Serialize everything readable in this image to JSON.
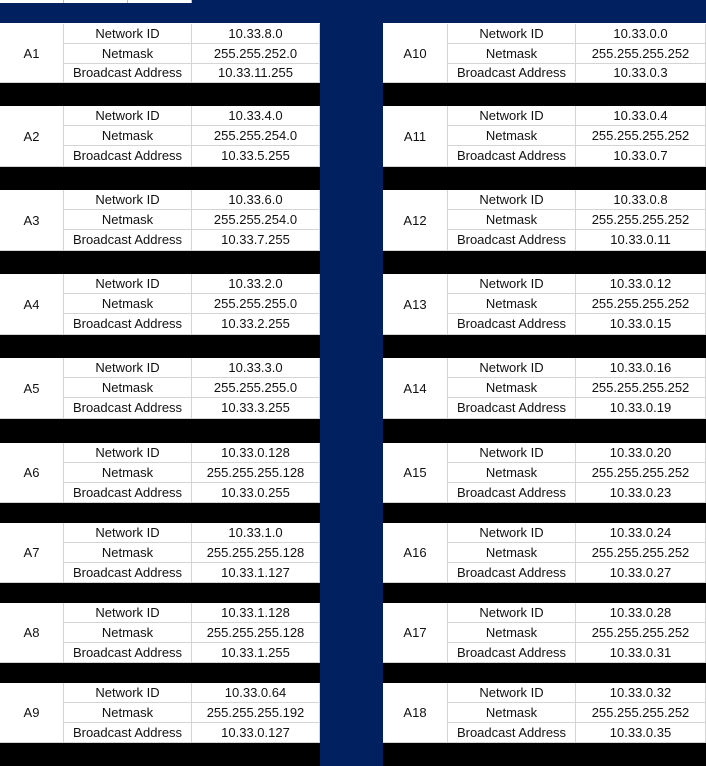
{
  "subnets_left": [
    {
      "id": "A1",
      "network": "10.33.8.0",
      "netmask": "255.255.252.0",
      "broadcast": "10.33.11.255"
    },
    {
      "id": "A2",
      "network": "10.33.4.0",
      "netmask": "255.255.254.0",
      "broadcast": "10.33.5.255"
    },
    {
      "id": "A3",
      "network": "10.33.6.0",
      "netmask": "255.255.254.0",
      "broadcast": "10.33.7.255"
    },
    {
      "id": "A4",
      "network": "10.33.2.0",
      "netmask": "255.255.255.0",
      "broadcast": "10.33.2.255"
    },
    {
      "id": "A5",
      "network": "10.33.3.0",
      "netmask": "255.255.255.0",
      "broadcast": "10.33.3.255"
    },
    {
      "id": "A6",
      "network": "10.33.0.128",
      "netmask": "255.255.255.128",
      "broadcast": "10.33.0.255"
    },
    {
      "id": "A7",
      "network": "10.33.1.0",
      "netmask": "255.255.255.128",
      "broadcast": "10.33.1.127"
    },
    {
      "id": "A8",
      "network": "10.33.1.128",
      "netmask": "255.255.255.128",
      "broadcast": "10.33.1.255"
    },
    {
      "id": "A9",
      "network": "10.33.0.64",
      "netmask": "255.255.255.192",
      "broadcast": "10.33.0.127"
    }
  ],
  "subnets_right": [
    {
      "id": "A10",
      "network": "10.33.0.0",
      "netmask": "255.255.255.252",
      "broadcast": "10.33.0.3"
    },
    {
      "id": "A11",
      "network": "10.33.0.4",
      "netmask": "255.255.255.252",
      "broadcast": "10.33.0.7"
    },
    {
      "id": "A12",
      "network": "10.33.0.8",
      "netmask": "255.255.255.252",
      "broadcast": "10.33.0.11"
    },
    {
      "id": "A13",
      "network": "10.33.0.12",
      "netmask": "255.255.255.252",
      "broadcast": "10.33.0.15"
    },
    {
      "id": "A14",
      "network": "10.33.0.16",
      "netmask": "255.255.255.252",
      "broadcast": "10.33.0.19"
    },
    {
      "id": "A15",
      "network": "10.33.0.20",
      "netmask": "255.255.255.252",
      "broadcast": "10.33.0.23"
    },
    {
      "id": "A16",
      "network": "10.33.0.24",
      "netmask": "255.255.255.252",
      "broadcast": "10.33.0.27"
    },
    {
      "id": "A17",
      "network": "10.33.0.28",
      "netmask": "255.255.255.252",
      "broadcast": "10.33.0.31"
    },
    {
      "id": "A18",
      "network": "10.33.0.32",
      "netmask": "255.255.255.252",
      "broadcast": "10.33.0.35"
    }
  ],
  "labels": {
    "network": "Network ID",
    "netmask": "Netmask",
    "broadcast": "Broadcast Address"
  },
  "colors": {
    "header_band": "#002060",
    "divider_column": "#002060",
    "separator_rows": "#000000",
    "grid": "#d4d4d4"
  }
}
